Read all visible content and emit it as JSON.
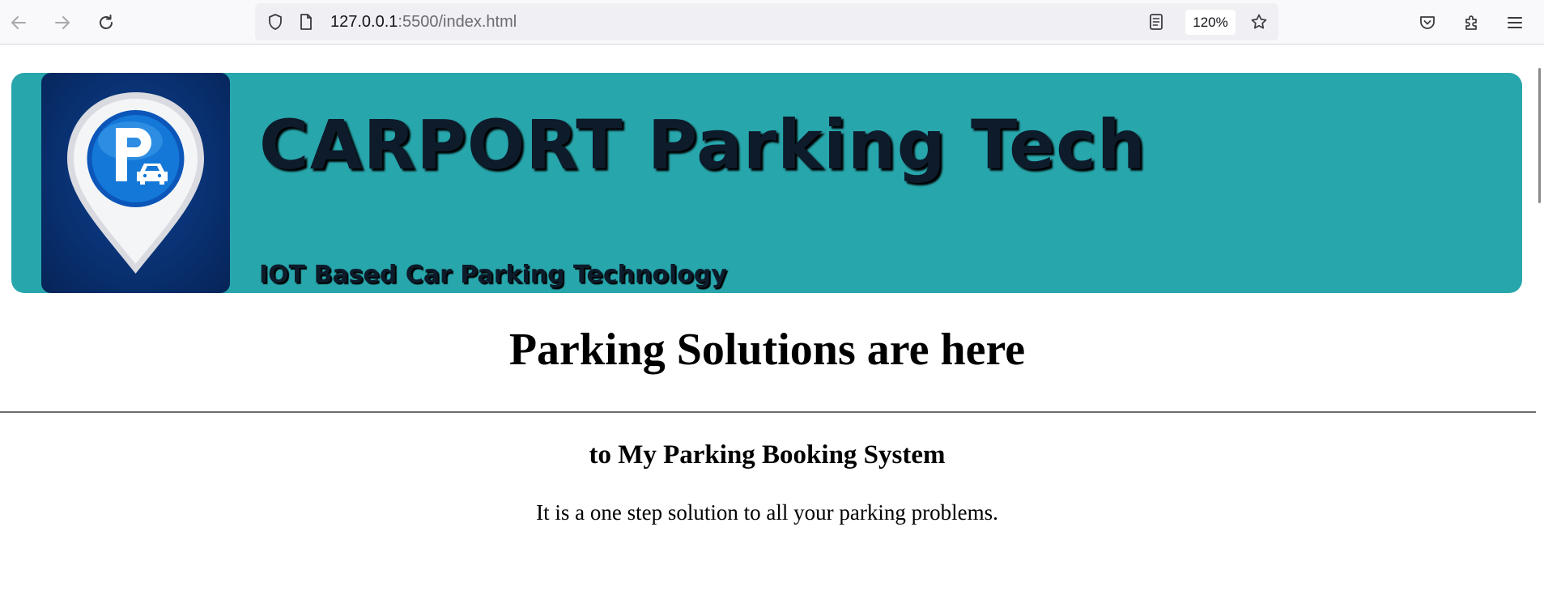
{
  "browser": {
    "url_host": "127.0.0.1",
    "url_path": ":5500/index.html",
    "zoom": "120%",
    "icons": {
      "back": "back-arrow-icon",
      "forward": "forward-arrow-icon",
      "reload": "reload-icon",
      "tracking": "shield-icon",
      "page": "page-icon",
      "reader": "reader-view-icon",
      "bookmark": "star-icon",
      "pocket": "pocket-icon",
      "extensions": "extensions-icon",
      "menu": "hamburger-menu-icon"
    }
  },
  "header": {
    "title": "CARPORT Parking Tech",
    "tagline": "IOT Based Car Parking Technology",
    "logo": "parking-location-pin-logo",
    "background_color": "#27a6ac",
    "logo_background_color": "#0a3478"
  },
  "main": {
    "headline": "Parking Solutions are here",
    "subheading": "to My Parking Booking System",
    "description": "It is a one step solution to all your parking problems."
  }
}
